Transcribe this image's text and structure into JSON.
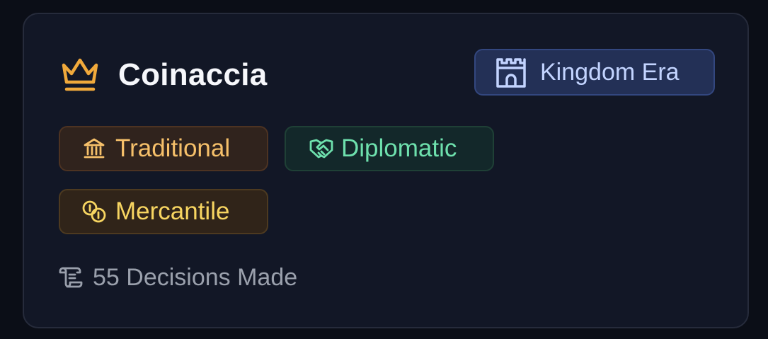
{
  "card": {
    "title": "Coinaccia",
    "title_icon": "crown-icon",
    "era": {
      "label": "Kingdom Era",
      "icon": "castle-icon"
    },
    "tags": [
      {
        "label": "Traditional",
        "icon": "bank-icon",
        "color": "#f6c06a"
      },
      {
        "label": "Diplomatic",
        "icon": "handshake-icon",
        "color": "#6ee0ad"
      },
      {
        "label": "Mercantile",
        "icon": "coins-icon",
        "color": "#f7d561"
      }
    ],
    "decisions": {
      "label": "55 Decisions Made",
      "icon": "scroll-icon"
    }
  },
  "colors": {
    "crown": "#f0a93b",
    "background": "#121726",
    "era_text": "#c3d4ff"
  }
}
